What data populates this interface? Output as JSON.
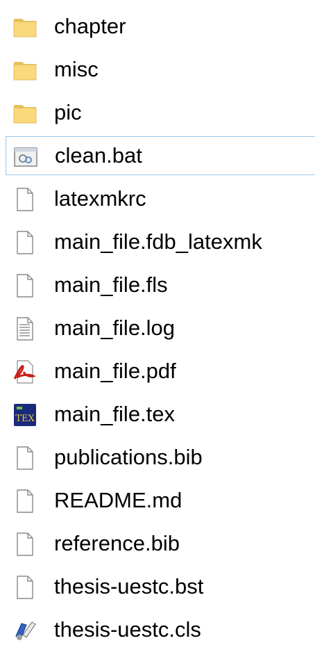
{
  "files": [
    {
      "name": "chapter",
      "icon": "folder-icon",
      "type": "folder"
    },
    {
      "name": "misc",
      "icon": "folder-icon",
      "type": "folder"
    },
    {
      "name": "pic",
      "icon": "folder-icon",
      "type": "folder"
    },
    {
      "name": "clean.bat",
      "icon": "batch-file-icon",
      "type": "bat",
      "focused": true
    },
    {
      "name": "latexmkrc",
      "icon": "blank-file-icon",
      "type": "blank"
    },
    {
      "name": "main_file.fdb_latexmk",
      "icon": "blank-file-icon",
      "type": "blank"
    },
    {
      "name": "main_file.fls",
      "icon": "blank-file-icon",
      "type": "blank"
    },
    {
      "name": "main_file.log",
      "icon": "text-file-icon",
      "type": "text"
    },
    {
      "name": "main_file.pdf",
      "icon": "pdf-file-icon",
      "type": "pdf"
    },
    {
      "name": "main_file.tex",
      "icon": "tex-file-icon",
      "type": "tex"
    },
    {
      "name": "publications.bib",
      "icon": "blank-file-icon",
      "type": "blank"
    },
    {
      "name": "README.md",
      "icon": "blank-file-icon",
      "type": "blank"
    },
    {
      "name": "reference.bib",
      "icon": "blank-file-icon",
      "type": "blank"
    },
    {
      "name": "thesis-uestc.bst",
      "icon": "blank-file-icon",
      "type": "blank"
    },
    {
      "name": "thesis-uestc.cls",
      "icon": "cls-file-icon",
      "type": "cls"
    }
  ],
  "colors": {
    "folder_body": "#f9d97a",
    "folder_tab": "#e8c25e",
    "selection_border": "#99c7f0",
    "pdf_red": "#c8201d",
    "tex_bg": "#1a2a7a"
  }
}
